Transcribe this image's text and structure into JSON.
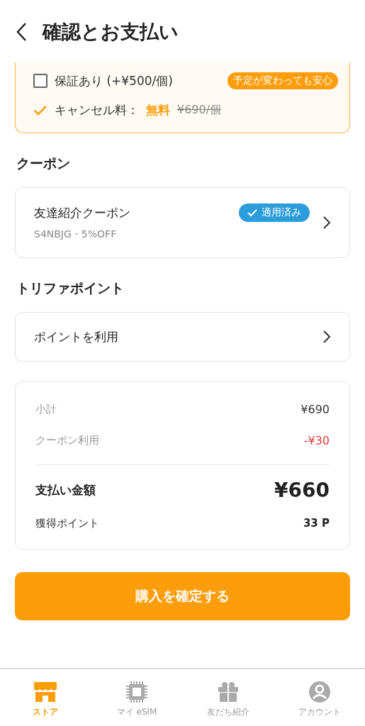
{
  "header": {
    "title": "確認とお支払い"
  },
  "options": {
    "warranty": {
      "label": "保証あり (+¥500/個)",
      "checked": false,
      "badge": "予定が変わっても安心"
    },
    "cancel_fee": {
      "label": "キャンセル料：",
      "value": "無料",
      "original_price": "¥690/個"
    }
  },
  "coupon_section": {
    "heading": "クーポン",
    "coupon": {
      "name": "友達紹介クーポン",
      "detail": "S4NBJG・5%OFF",
      "applied": true,
      "status": "適用済み"
    }
  },
  "points_section": {
    "heading": "トリファポイント",
    "action": "ポイントを利用"
  },
  "summary": {
    "rows": [
      {
        "label": "小計",
        "value": "¥690",
        "kind": "plain"
      },
      {
        "label": "クーポン利用",
        "value": "-¥30",
        "kind": "discount"
      }
    ],
    "total": {
      "label": "支払い金額",
      "value": "¥660"
    },
    "earned": {
      "label": "獲得ポイント",
      "value": "33 P"
    }
  },
  "confirm_button": "購入を確定する",
  "tabs": [
    {
      "label": "ストア",
      "kind": "store",
      "selected": true
    },
    {
      "label": "マイ eSIM",
      "kind": "chip",
      "selected": false
    },
    {
      "label": "友だち紹介",
      "kind": "gift",
      "selected": false
    },
    {
      "label": "アカウント",
      "kind": "account",
      "selected": false
    }
  ]
}
